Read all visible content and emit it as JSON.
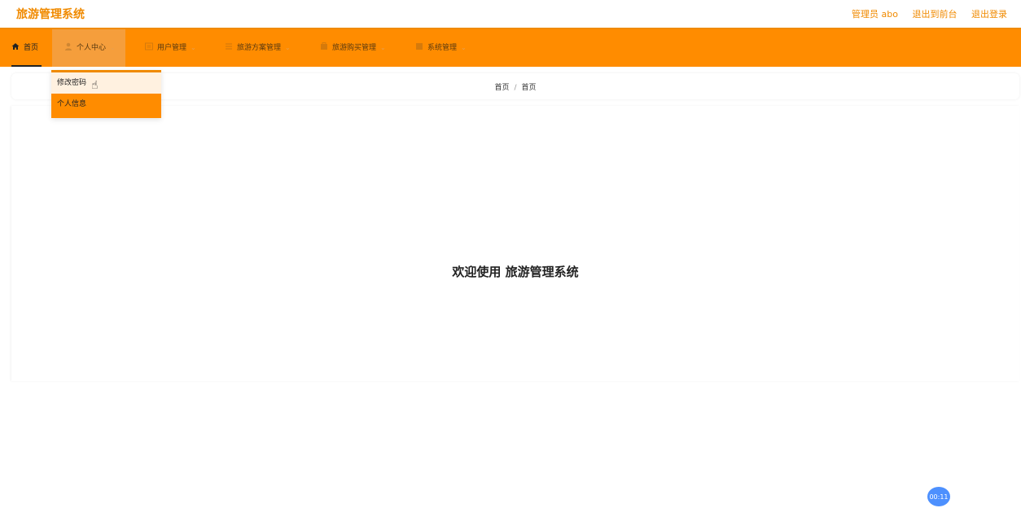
{
  "app": {
    "title": "旅游管理系统"
  },
  "header_links": {
    "admin": "管理员 abo",
    "to_front": "退出到前台",
    "logout": "退出登录"
  },
  "nav": {
    "home": "首页",
    "personal_center": "个人中心",
    "user_mgmt": "用户管理",
    "tour_plan_mgmt": "旅游方案管理",
    "tour_purchase_mgmt": "旅游购买管理",
    "system_mgmt": "系统管理"
  },
  "dropdown": {
    "change_password": "修改密码",
    "personal_info": "个人信息"
  },
  "breadcrumb": {
    "root": "首页",
    "sep": "/",
    "current": "首页"
  },
  "welcome": "欢迎使用 旅游管理系统",
  "timer": "00:11",
  "colors": {
    "accent": "#ff8c00",
    "brand_text": "#f08a00",
    "timer_bg": "#4d90fe"
  },
  "icons": {
    "home": "home-icon",
    "personal_center": "user-icon",
    "user_mgmt": "user-list-icon",
    "tour_plan_mgmt": "list-icon",
    "tour_purchase_mgmt": "cart-icon",
    "system_mgmt": "settings-icon",
    "cursor": "hand-pointer-icon"
  }
}
